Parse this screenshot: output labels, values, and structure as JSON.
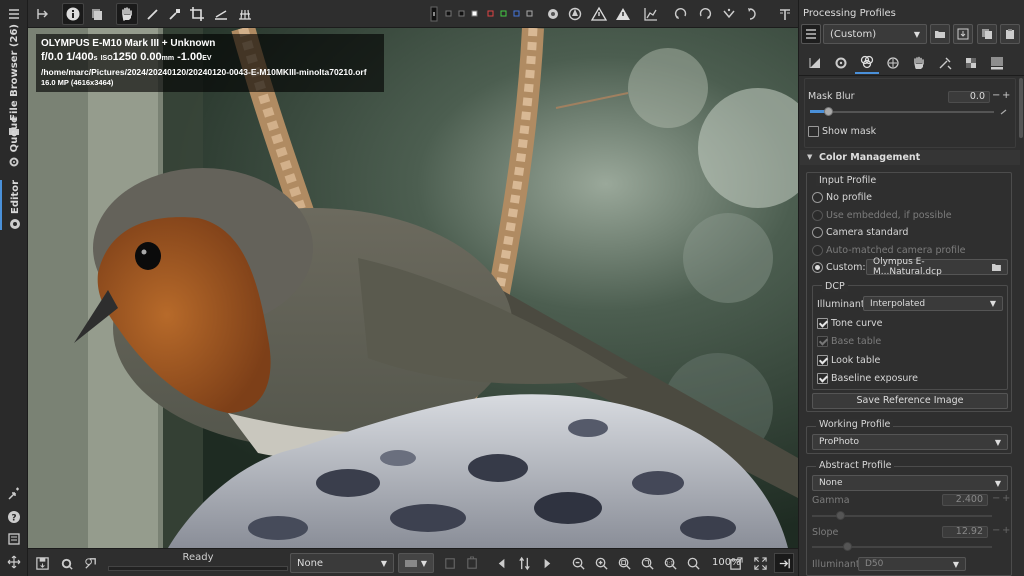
{
  "left_tabs": {
    "file_browser": "File Browser (26)",
    "queue": "Queue",
    "editor": "Editor"
  },
  "left_strip_icons": [
    "folder-icon",
    "gear-icon",
    "aperture-icon",
    "new-window-icon",
    "help-icon",
    "shortcuts-icon",
    "move-icon"
  ],
  "top_toolbar_icons": [
    "before-after-icon",
    "info-icon",
    "history-icon",
    "hand-icon",
    "color-picker-icon",
    "white-balance-icon",
    "crop-icon",
    "straighten-icon",
    "grid-icon",
    "indicator-icon",
    "focus-mask-icon",
    "preview-mode-icon",
    "clipped-shadow-icon",
    "clipped-highlight-icon",
    "histogram-icon",
    "rotate-left-icon",
    "rotate-right-icon",
    "flip-horizontal-icon",
    "flip-vertical-icon",
    "processing-profile-icon"
  ],
  "image_info": {
    "camera": "OLYMPUS E-M10 Mark III + Unknown",
    "aperture": "f/0.0",
    "shutter": "1/400",
    "shutter_unit": "s",
    "iso_label": "ISO",
    "iso": "1250",
    "focal": "0.00",
    "focal_unit": "mm",
    "ev": "-1.00",
    "ev_unit": "EV",
    "path": "/home/marc/Pictures/2024/20240120/20240120-0043-E-M10MKIII-minolta70210.orf",
    "size": "16.0 MP (4616x3464)"
  },
  "bottom_bar": {
    "status": "Ready",
    "progress": 0,
    "preset_value": "None",
    "zoom": "100%"
  },
  "right_panel": {
    "title": "Processing Profiles",
    "profile_value": "(Custom)",
    "mask_blur": {
      "label": "Mask Blur",
      "value": "0.0"
    },
    "show_mask": "Show mask",
    "color_management": "Color Management",
    "input_profile": {
      "title": "Input Profile",
      "options": [
        "No profile",
        "Use embedded, if possible",
        "Camera standard",
        "Auto-matched camera profile",
        "Custom:"
      ],
      "custom_file": "Olympus E-M...Natural.dcp"
    },
    "dcp": {
      "title": "DCP",
      "illuminant_label": "Illuminant:",
      "illuminant_value": "Interpolated",
      "tone_curve": "Tone curve",
      "base_table": "Base table",
      "look_table": "Look table",
      "baseline_exposure": "Baseline exposure",
      "save_button": "Save Reference Image"
    },
    "working_profile": {
      "title": "Working Profile",
      "value": "ProPhoto"
    },
    "abstract_profile": {
      "title": "Abstract Profile",
      "value": "None",
      "gamma_label": "Gamma",
      "gamma_value": "2.400",
      "slope_label": "Slope",
      "slope_value": "12.92",
      "illuminant_label": "Illuminant:",
      "illuminant_value": "D50"
    }
  }
}
